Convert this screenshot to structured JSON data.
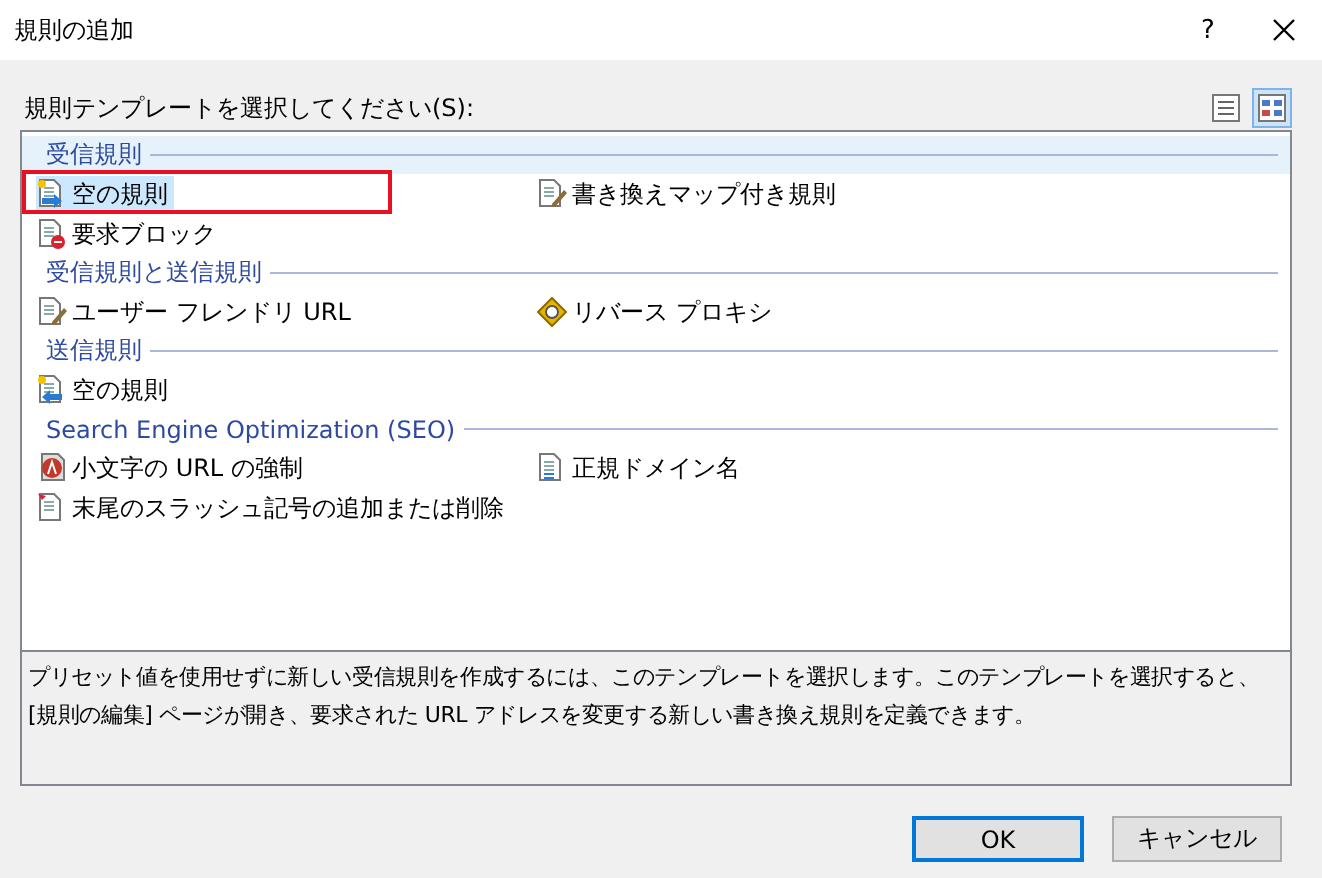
{
  "window": {
    "title": "規則の追加",
    "help": "?"
  },
  "prompt": "規則テンプレートを選択してください(S):",
  "view_buttons": [
    {
      "kind": "details",
      "selected": false
    },
    {
      "kind": "tiles",
      "selected": true
    }
  ],
  "groups": [
    {
      "title": "受信規則",
      "highlighted": true,
      "items": [
        {
          "label": "空の規則",
          "kind": "inbound",
          "selected": true,
          "framed": true
        },
        {
          "label": "書き換えマップ付き規則",
          "kind": "edit",
          "selected": false,
          "framed": false
        },
        {
          "label": "要求ブロック",
          "kind": "block",
          "selected": false,
          "framed": false
        }
      ]
    },
    {
      "title": "受信規則と送信規則",
      "highlighted": false,
      "items": [
        {
          "label": "ユーザー フレンドリ URL",
          "kind": "edit",
          "selected": false,
          "framed": false
        },
        {
          "label": "リバース プロキシ",
          "kind": "proxy",
          "selected": false,
          "framed": false
        }
      ]
    },
    {
      "title": "送信規則",
      "highlighted": false,
      "items": [
        {
          "label": "空の規則",
          "kind": "outbound",
          "selected": false,
          "framed": false
        }
      ]
    },
    {
      "title": "Search Engine Optimization (SEO)",
      "highlighted": false,
      "items": [
        {
          "label": "小文字の URL の強制",
          "kind": "lowercase",
          "selected": false,
          "framed": false
        },
        {
          "label": "正規ドメイン名",
          "kind": "document",
          "selected": false,
          "framed": false
        },
        {
          "label": "末尾のスラッシュ記号の追加または削除",
          "kind": "flagged",
          "selected": false,
          "framed": false
        }
      ]
    }
  ],
  "description": "プリセット値を使用せずに新しい受信規則を作成するには、このテンプレートを選択します。このテンプレートを選択すると、[規則の編集] ページが開き、要求された URL アドレスを変更する新しい書き換え規則を定義できます。",
  "buttons": [
    {
      "label": "OK",
      "default": true
    },
    {
      "label": "キャンセル",
      "default": false
    }
  ]
}
